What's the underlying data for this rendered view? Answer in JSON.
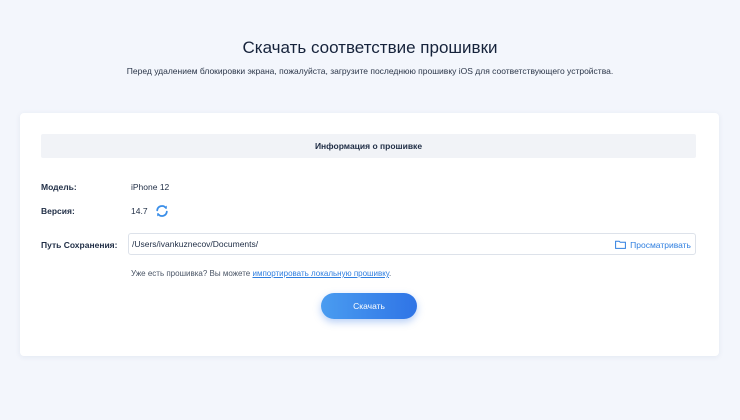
{
  "page": {
    "title": "Скачать соответствие прошивки",
    "subtitle": "Перед удалением блокировки экрана, пожалуйста, загрузите последнюю прошивку iOS для соответствующего устройства."
  },
  "firmware_card": {
    "section_title": "Информация о прошивке",
    "model_label": "Модель:",
    "model_value": "iPhone 12",
    "version_label": "Версия:",
    "version_value": "14.7",
    "refresh_icon": "refresh-icon",
    "save_path_label": "Путь Сохранения:",
    "save_path_value": "/Users/ivankuznecov/Documents/",
    "browse_icon": "folder-icon",
    "browse_label": "Просматривать",
    "hint_prefix": "Уже есть прошивка? Вы можете ",
    "hint_link": "импортировать локальную прошивку",
    "hint_suffix": ".",
    "download_label": "Скачать"
  },
  "colors": {
    "accent": "#2f7fe0",
    "background": "#f3f6fc",
    "card": "#ffffff",
    "header_bar": "#f1f3f7"
  }
}
